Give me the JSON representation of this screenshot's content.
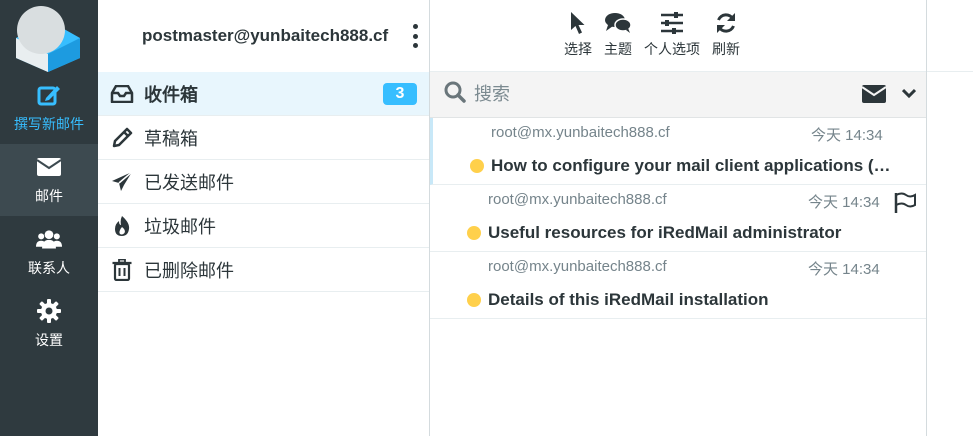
{
  "nav": {
    "compose": "撰写新邮件",
    "mail": "邮件",
    "contacts": "联系人",
    "settings": "设置"
  },
  "account": "postmaster@yunbaitech888.cf",
  "folders": [
    {
      "label": "收件箱",
      "icon": "inbox-icon",
      "badge": "3"
    },
    {
      "label": "草稿箱",
      "icon": "pencil-icon"
    },
    {
      "label": "已发送邮件",
      "icon": "paper-plane-icon"
    },
    {
      "label": "垃圾邮件",
      "icon": "fire-icon"
    },
    {
      "label": "已删除邮件",
      "icon": "trash-icon"
    }
  ],
  "toolbar": {
    "select": "选择",
    "theme": "主题",
    "options": "个人选项",
    "refresh": "刷新"
  },
  "search": {
    "placeholder": "搜索"
  },
  "messages": [
    {
      "from": "root@mx.yunbaitech888.cf",
      "date": "今天 14:34",
      "subject": "How to configure your mail client applications (…"
    },
    {
      "from": "root@mx.yunbaitech888.cf",
      "date": "今天 14:34",
      "subject": "Useful resources for iRedMail administrator"
    },
    {
      "from": "root@mx.yunbaitech888.cf",
      "date": "今天 14:34",
      "subject": "Details of this iRedMail installation"
    }
  ],
  "colors": {
    "accent": "#37beff",
    "nav_bg": "#2f3a3f",
    "unread_dot": "#ffd04b"
  }
}
